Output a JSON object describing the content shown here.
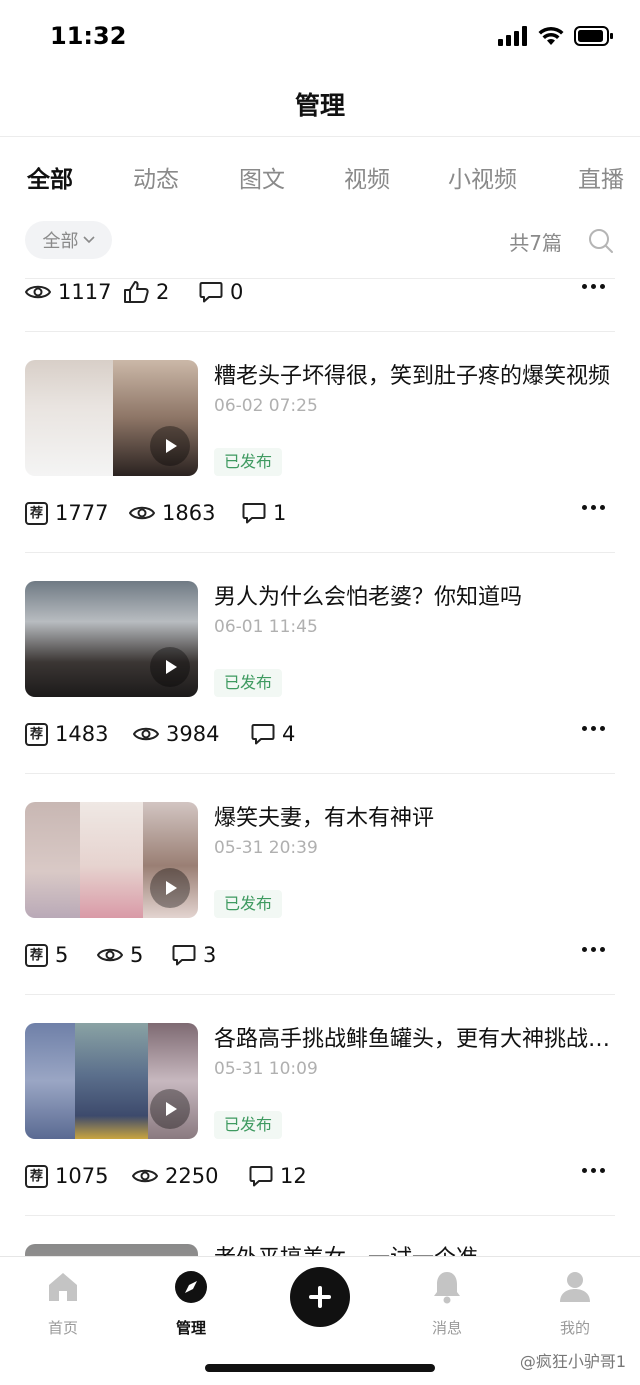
{
  "status_bar": {
    "time": "11:32"
  },
  "header": {
    "title": "管理"
  },
  "tabs": [
    {
      "label": "全部"
    },
    {
      "label": "动态"
    },
    {
      "label": "图文"
    },
    {
      "label": "视频"
    },
    {
      "label": "小视频"
    },
    {
      "label": "直播"
    }
  ],
  "filter": {
    "label": "全部",
    "count_text": "共7篇"
  },
  "partial_item": {
    "views": "1117",
    "likes": "2",
    "comments": "0"
  },
  "items": [
    {
      "title": "糟老头子坏得很，笑到肚子疼的爆笑视频",
      "date": "06-02 07:25",
      "status": "已发布",
      "recommended": "1777",
      "views": "1863",
      "comments": "1"
    },
    {
      "title": "男人为什么会怕老婆？你知道吗",
      "date": "06-01 11:45",
      "status": "已发布",
      "recommended": "1483",
      "views": "3984",
      "comments": "4"
    },
    {
      "title": "爆笑夫妻，有木有神评",
      "date": "05-31 20:39",
      "status": "已发布",
      "recommended": "5",
      "views": "5",
      "comments": "3"
    },
    {
      "title": "各路高手挑战鲱鱼罐头，更有大神挑战成功",
      "date": "05-31 10:09",
      "status": "已发布",
      "recommended": "1075",
      "views": "2250",
      "comments": "12"
    }
  ],
  "partial_bottom_title": "老外平搞美女，一试一个准",
  "rec_badge": "荐",
  "tab_bar": [
    {
      "label": "首页",
      "icon": "home-icon"
    },
    {
      "label": "管理",
      "icon": "compass-icon"
    },
    {
      "label": "",
      "icon": "plus-icon"
    },
    {
      "label": "消息",
      "icon": "bell-icon"
    },
    {
      "label": "我的",
      "icon": "user-icon"
    }
  ],
  "watermark": "@疯狂小驴哥1",
  "colors": {
    "accent_green": "#3e9a60",
    "badge_bg": "#f2f8f4",
    "muted_text": "#8a8a8a"
  }
}
